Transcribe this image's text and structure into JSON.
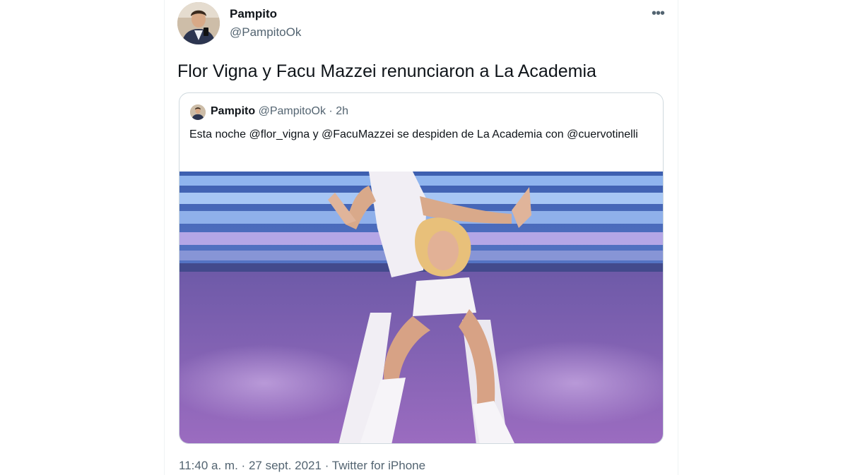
{
  "tweet": {
    "author_name": "Pampito",
    "author_handle": "@PampitoOk",
    "more_icon": "more-horizontal-icon",
    "text": "Flor Vigna y Facu Mazzei renunciaron a La Academia",
    "time": "11:40 a. m.",
    "separator": "·",
    "date": "27 sept. 2021",
    "source": "Twitter for iPhone"
  },
  "quoted": {
    "author_name": "Pampito",
    "author_handle": "@PampitoOk",
    "separator": "·",
    "time_ago": "2h",
    "text": "Esta noche @flor_vigna y @FacuMazzei se despiden de La Academia con @cuervotinelli"
  },
  "colors": {
    "text_primary": "#0f1419",
    "text_secondary": "#536471",
    "border": "#cfd9de",
    "stage_floor": "#8d62b8",
    "stage_lights": "#6e9be0"
  }
}
